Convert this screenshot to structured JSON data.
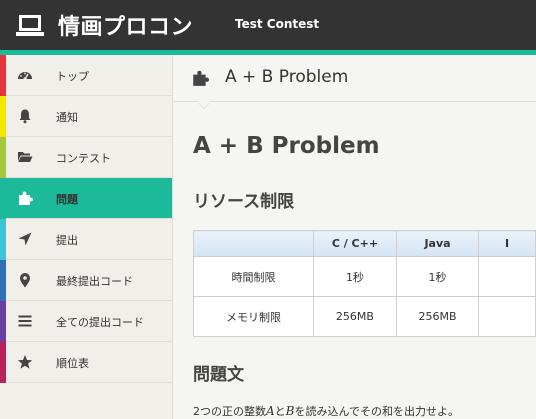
{
  "header": {
    "site_title": "情画プロコン",
    "contest_name": "Test Contest",
    "logo_icon": "laptop-icon"
  },
  "colors": {
    "header_bg": "#333333",
    "accent": "#1cb99b"
  },
  "sidebar": {
    "items": [
      {
        "label": "トップ",
        "icon": "dashboard-icon",
        "stripe": "#e5343d",
        "active": false
      },
      {
        "label": "通知",
        "icon": "bell-icon",
        "stripe": "#f5e600",
        "active": false
      },
      {
        "label": "コンテスト",
        "icon": "folder-open-icon",
        "stripe": "#a5c93a",
        "active": false
      },
      {
        "label": "問題",
        "icon": "puzzle-icon",
        "stripe": "#1cb99b",
        "active": true
      },
      {
        "label": "提出",
        "icon": "location-arrow-icon",
        "stripe": "#3ec3d5",
        "active": false
      },
      {
        "label": "最終提出コード",
        "icon": "map-marker-icon",
        "stripe": "#2f6fb5",
        "active": false
      },
      {
        "label": "全ての提出コード",
        "icon": "list-icon",
        "stripe": "#6b3fa0",
        "active": false
      },
      {
        "label": "順位表",
        "icon": "star-icon",
        "stripe": "#b8235c",
        "active": false
      }
    ]
  },
  "main": {
    "breadcrumb_title": "A + B Problem",
    "breadcrumb_icon": "puzzle-icon",
    "problem_title": "A + B Problem",
    "resources_heading": "リソース制限",
    "limits_table": {
      "headers": [
        "",
        "C / C++",
        "Java",
        "Ι"
      ],
      "rows": [
        [
          "時間制限",
          "1秒",
          "1秒",
          ""
        ],
        [
          "メモリ制限",
          "256MB",
          "256MB",
          ""
        ]
      ]
    },
    "statement_heading": "問題文",
    "statement": {
      "part1": "2つの正の整数",
      "var_a": "A",
      "part2": "と",
      "var_b": "B",
      "part3": "を読み込んでその和を出力せよ。"
    }
  }
}
